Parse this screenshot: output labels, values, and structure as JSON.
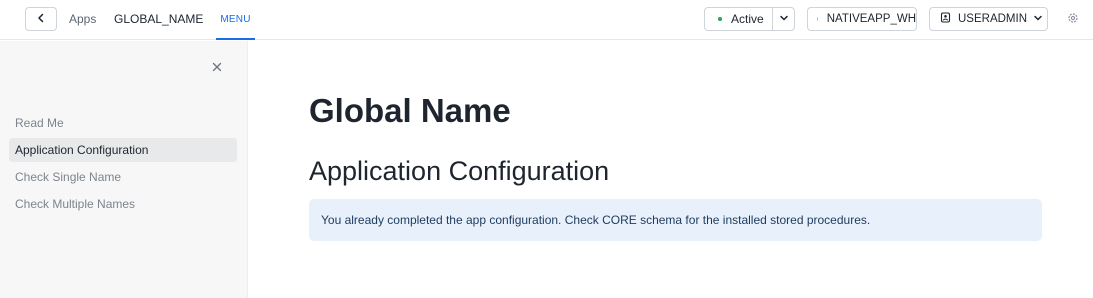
{
  "topbar": {
    "back_icon": "chevron-left-icon",
    "breadcrumb_apps": "Apps",
    "breadcrumb_app_name": "GLOBAL_NAME",
    "tab_menu": "MENU",
    "status_label": "Active",
    "status_color": "#21a366",
    "warehouse_label": "NATIVEAPP_WH",
    "role_label": "USERADMIN",
    "accent_color": "#1a6ce7"
  },
  "sidebar": {
    "items": [
      {
        "label": "Read Me",
        "active": false
      },
      {
        "label": "Application Configuration",
        "active": true
      },
      {
        "label": "Check Single Name",
        "active": false
      },
      {
        "label": "Check Multiple Names",
        "active": false
      }
    ]
  },
  "main": {
    "title": "Global Name",
    "section_title": "Application Configuration",
    "alert_text": "You already completed the app configuration. Check CORE schema for the installed stored procedures."
  }
}
